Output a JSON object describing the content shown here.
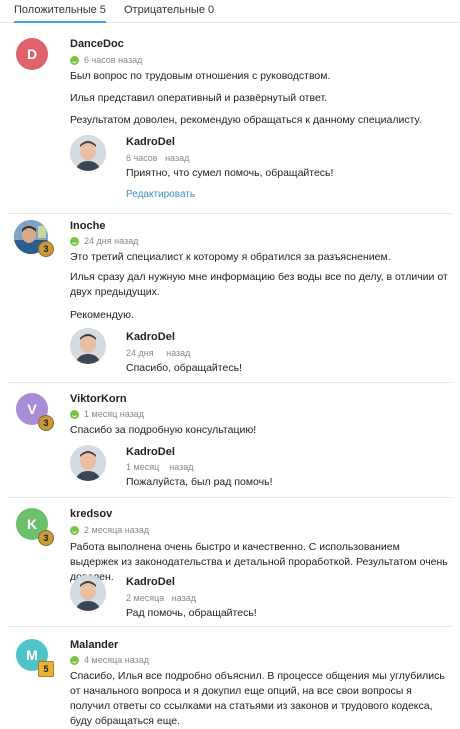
{
  "tabs": [
    {
      "label": "Положительные",
      "count": "5"
    },
    {
      "label": "Отрицательные",
      "count": "0"
    }
  ],
  "colors": {
    "accent": "#4aa3df",
    "positive": "#7dc243",
    "badge": "#c99a3c"
  },
  "reviews": [
    {
      "initial": "D",
      "avatar_color": "#e0636b",
      "badge": "",
      "user": "DanceDoc",
      "time": "6 часов назад",
      "paragraphs": [
        "Был вопрос по трудовым отношения с руководством.",
        "Илья представил оперативный и развёрнутый ответ.",
        "Результатом доволен, рекомендую обращаться к данному специалисту."
      ],
      "reply": {
        "name": "KadroDel",
        "time": "6 часов   назад",
        "text": "Приятно, что сумел помочь, обращайтесь!",
        "edit": "Редактировать"
      }
    },
    {
      "initial": "",
      "avatar_color": "#6b8aa6",
      "badge": "3",
      "user": "Inoche",
      "time": "24 дня назад",
      "paragraphs": [
        "Это третий специалист к которому я обратился за разъяснением.",
        "Илья сразу дал нужную мне информацию без воды все по делу, в отличии от двух предыдущих.",
        "Рекомендую."
      ],
      "reply": {
        "name": "KadroDel",
        "time": "24 дня     назад",
        "text": "Спасибо, обращайтесь!"
      }
    },
    {
      "initial": "V",
      "avatar_color": "#a98bd6",
      "badge": "3",
      "user": "ViktorKorn",
      "time": "1 месяц назад",
      "paragraphs": [
        "Спасибо за подробную консультацию!"
      ],
      "reply": {
        "name": "KadroDel",
        "time": "1 месяц    назад",
        "text": "Пожалуйста, был рад помочь!"
      }
    },
    {
      "initial": "K",
      "avatar_color": "#6cc06c",
      "badge": "3",
      "user": "kredsov",
      "time": "2 месяца назад",
      "paragraphs": [
        "Работа выполнена очень быстро и качественно. С использованием выдержек из законодательства и детальной проработкой. Результатом очень доволен."
      ],
      "reply": {
        "name": "KadroDel",
        "time": "2 месяца   назад",
        "text": "Рад помочь, обращайтесь!"
      }
    },
    {
      "initial": "M",
      "avatar_color": "#4fc3c8",
      "badge": "5",
      "user": "Malander",
      "time": "4 месяца назад",
      "paragraphs": [
        "Спасибо, Илья все подробно объяснил. В процессе общения мы углубились от начального вопроса и я докупил еще опций, на все свои вопросы я получил ответы со ссылками на статьями из законов и трудового кодекса, буду обращаться еще."
      ]
    }
  ]
}
